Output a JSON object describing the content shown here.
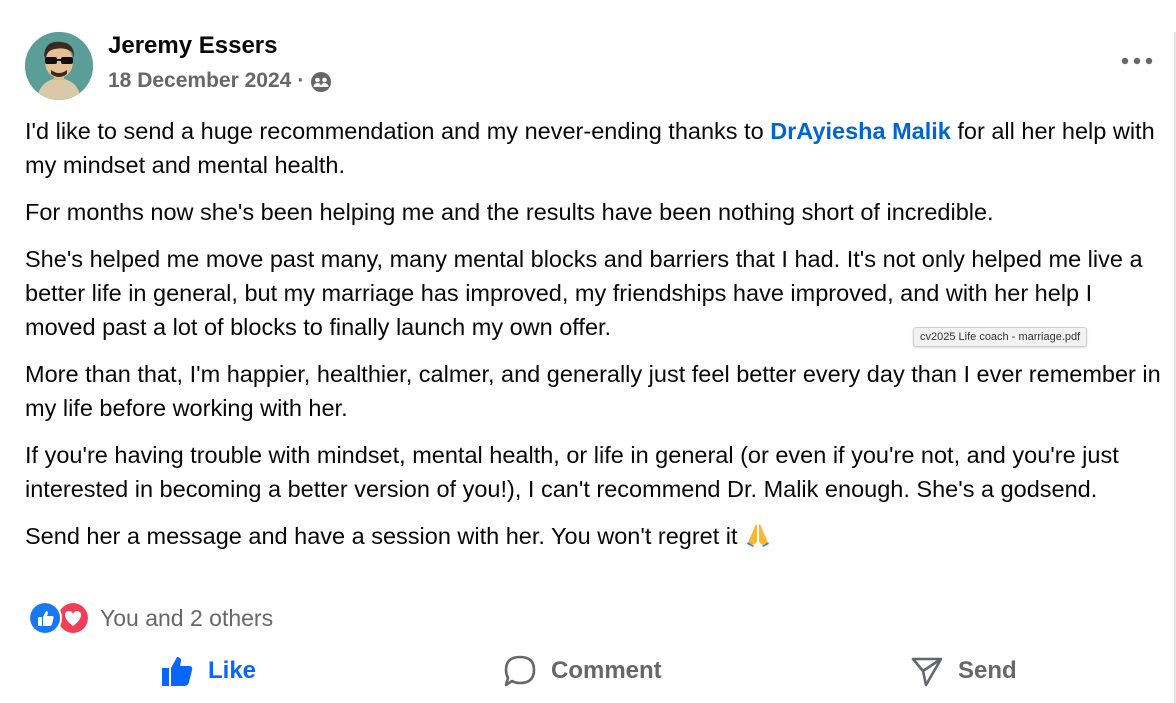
{
  "post": {
    "author": "Jeremy Essers",
    "date": "18 December 2024",
    "separator": "·",
    "privacy_icon": "friends-icon",
    "paragraphs": {
      "p1_before": "I'd like to send a huge recommendation and my never-ending thanks to ",
      "p1_mention": "DrAyiesha Malik",
      "p1_after": " for all her help with my mindset and mental health.",
      "p2": "For months now she's been helping me and the results have been nothing short of incredible.",
      "p3": "She's helped me move past many, many mental blocks and barriers that I had. It's not only helped me live a better life in general, but my marriage has improved, my friendships have improved, and with her help I moved past a lot of blocks to finally launch my own offer.",
      "p4": "More than that, I'm happier, healthier, calmer, and generally just feel better every day than I ever remember in my life before working with her.",
      "p5": "If you're having trouble with mindset, mental health, or life in general (or even if you're not, and you're just interested in becoming a better version of you!), I can't recommend Dr. Malik enough. She's a godsend.",
      "p6": "Send her a message and have a session with her. You won't regret it ",
      "p6_emoji": "folded-hands-icon"
    },
    "tooltip": "cv2025 Life coach - marriage.pdf",
    "reactions": {
      "icons": [
        "like-reaction-icon",
        "love-reaction-icon"
      ],
      "summary": "You and 2 others"
    },
    "actions": {
      "like": "Like",
      "comment": "Comment",
      "send": "Send"
    }
  },
  "colors": {
    "accent_blue": "#0866ff",
    "mention_blue": "#0064d1",
    "secondary_text": "#65676b",
    "love_red": "#f33e58"
  }
}
